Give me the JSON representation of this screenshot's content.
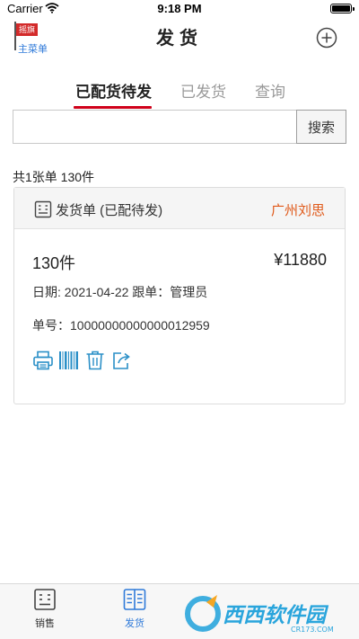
{
  "status_bar": {
    "carrier": "Carrier",
    "time": "9:18 PM"
  },
  "header": {
    "logo_flag_text": "摇旗",
    "logo_label": "主菜单",
    "title": "发货",
    "add_icon": "plus-circle-icon"
  },
  "tabs": [
    {
      "label": "已配货待发",
      "active": true
    },
    {
      "label": "已发货",
      "active": false
    },
    {
      "label": "查询",
      "active": false
    }
  ],
  "search": {
    "value": "",
    "placeholder": "",
    "button_label": "搜索"
  },
  "summary": "共1张单 130件",
  "order": {
    "type_label": "发货单 (已配待发)",
    "customer": "广州刘思",
    "quantity": "130件",
    "amount": "¥11880",
    "date_line": "日期: 2021-04-22 跟单：管理员",
    "order_no_line": "单号：10000000000000012959",
    "actions": [
      "printer-icon",
      "barcode-icon",
      "trash-icon",
      "share-icon"
    ]
  },
  "bottom_nav": [
    {
      "label": "销售",
      "icon": "sales-icon",
      "active": false
    },
    {
      "label": "发货",
      "icon": "shipping-list-icon",
      "active": true
    }
  ],
  "watermark": {
    "brand": "西西软件园",
    "site": "CR173.COM"
  },
  "colors": {
    "accent": "#2f7ad9",
    "tab_underline": "#d0021b",
    "customer": "#e05a1a",
    "action_icons": "#2a8fc7"
  }
}
